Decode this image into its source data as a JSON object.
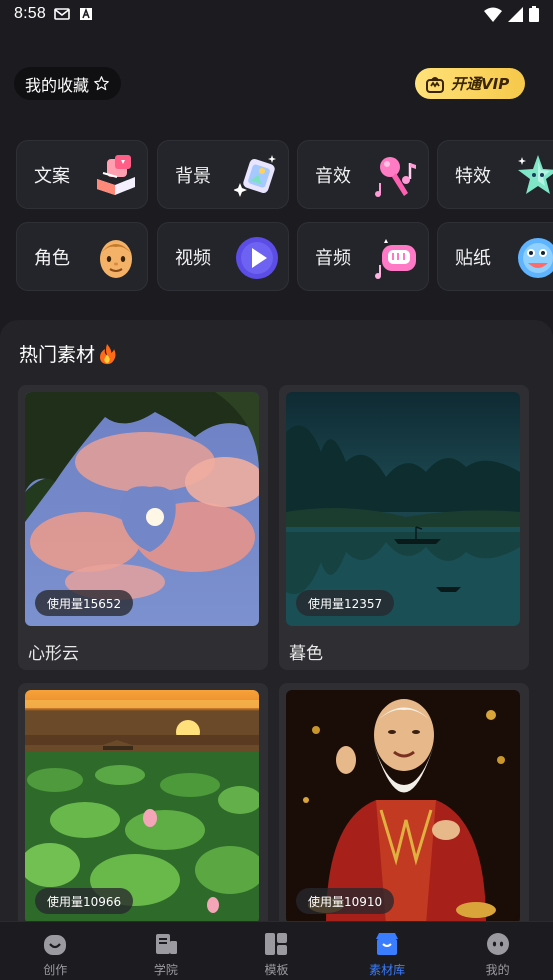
{
  "status_bar": {
    "time": "8:58"
  },
  "header": {
    "favorites_label": "我的收藏",
    "vip_label": "开通VIP"
  },
  "categories": [
    {
      "label": "文案",
      "icon": "copywriting-icon"
    },
    {
      "label": "背景",
      "icon": "background-icon"
    },
    {
      "label": "音效",
      "icon": "sound-effect-icon"
    },
    {
      "label": "特效",
      "icon": "special-effect-icon"
    },
    {
      "label": "角色",
      "icon": "character-icon"
    },
    {
      "label": "视频",
      "icon": "video-icon"
    },
    {
      "label": "音频",
      "icon": "audio-icon"
    },
    {
      "label": "贴纸",
      "icon": "sticker-icon"
    }
  ],
  "hot_section": {
    "title": "热门素材",
    "cards": [
      {
        "name": "心形云",
        "usage": "使用量15652"
      },
      {
        "name": "暮色",
        "usage": "使用量12357"
      },
      {
        "name": "",
        "usage": "使用量10966"
      },
      {
        "name": "",
        "usage": "使用量10910"
      }
    ]
  },
  "bottom_nav": [
    {
      "label": "创作",
      "icon": "create-icon",
      "active": false
    },
    {
      "label": "学院",
      "icon": "academy-icon",
      "active": false
    },
    {
      "label": "模板",
      "icon": "template-icon",
      "active": false
    },
    {
      "label": "素材库",
      "icon": "material-library-icon",
      "active": true
    },
    {
      "label": "我的",
      "icon": "profile-icon",
      "active": false
    }
  ],
  "colors": {
    "accent": "#3b7dff",
    "vip_gold": "#f6c84a",
    "background": "#1c1c20"
  }
}
